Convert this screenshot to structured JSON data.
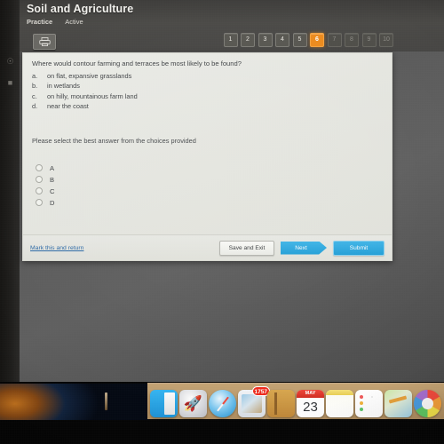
{
  "header": {
    "course_title": "Soil and Agriculture",
    "mode_label": "Practice",
    "status_label": "Active",
    "tool_icon": "printer-icon"
  },
  "pager": {
    "items": [
      {
        "label": "1",
        "state": "enabled"
      },
      {
        "label": "2",
        "state": "enabled"
      },
      {
        "label": "3",
        "state": "enabled"
      },
      {
        "label": "4",
        "state": "enabled"
      },
      {
        "label": "5",
        "state": "enabled"
      },
      {
        "label": "6",
        "state": "current"
      },
      {
        "label": "7",
        "state": "disabled"
      },
      {
        "label": "8",
        "state": "disabled"
      },
      {
        "label": "9",
        "state": "disabled"
      },
      {
        "label": "10",
        "state": "disabled"
      }
    ],
    "current_index": 6,
    "highlight_color": "#ef8c1c"
  },
  "question": {
    "stem": "Where would contour farming and terraces be most likely to be found?",
    "choices": [
      {
        "letter": "a.",
        "text": "on flat, expansive grasslands"
      },
      {
        "letter": "b.",
        "text": "in wetlands"
      },
      {
        "letter": "c.",
        "text": "on hilly, mountainous farm land"
      },
      {
        "letter": "d.",
        "text": "near the coast"
      }
    ],
    "instruction": "Please select the best answer from the choices provided",
    "answer_options": [
      {
        "label": "A",
        "selected": false
      },
      {
        "label": "B",
        "selected": false
      },
      {
        "label": "C",
        "selected": false
      },
      {
        "label": "D",
        "selected": false
      }
    ]
  },
  "footer": {
    "mark_link": "Mark this and return",
    "save_exit_label": "Save and Exit",
    "next_label": "Next",
    "submit_label": "Submit",
    "primary_color": "#29a8df"
  },
  "dock": {
    "items": [
      {
        "name": "finder-icon",
        "badge": null
      },
      {
        "name": "launchpad-icon",
        "badge": null
      },
      {
        "name": "safari-icon",
        "badge": null
      },
      {
        "name": "mail-icon",
        "badge": "1757"
      },
      {
        "name": "contacts-icon",
        "badge": null
      },
      {
        "name": "calendar-icon",
        "badge": null
      },
      {
        "name": "notes-icon",
        "badge": null
      },
      {
        "name": "reminders-icon",
        "badge": null
      },
      {
        "name": "maps-icon",
        "badge": null
      },
      {
        "name": "photos-icon",
        "badge": null
      }
    ],
    "calendar": {
      "month": "MAY",
      "day": "23"
    }
  },
  "colors": {
    "desktop": "#565656",
    "panel": "#e8e9e4",
    "accent_orange": "#ef8c1c",
    "accent_blue": "#29a8df"
  }
}
